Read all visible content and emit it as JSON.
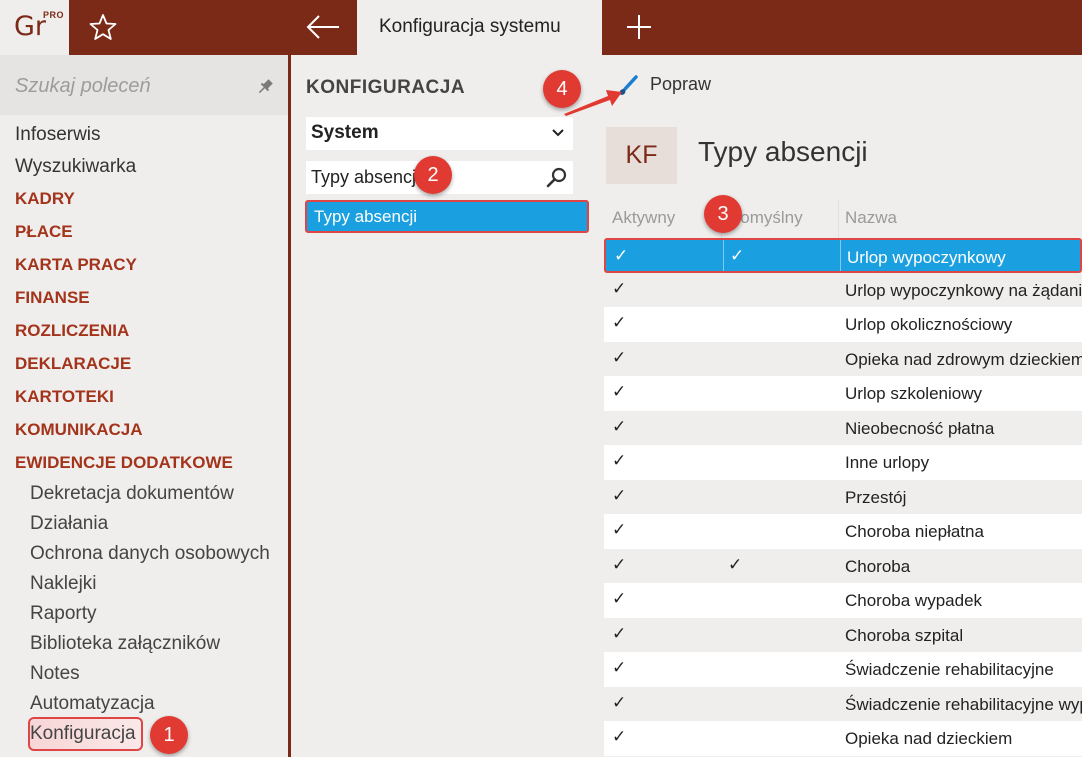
{
  "topbar": {
    "logo_text": "Gr",
    "logo_badge": "PRO",
    "tab_title": "Konfiguracja systemu",
    "icons": [
      "star-icon",
      "back-arrow-icon",
      "plus-icon"
    ]
  },
  "sidebar": {
    "search_placeholder": "Szukaj poleceń",
    "top_items": [
      "Infoserwis",
      "Wyszukiwarka"
    ],
    "sections": [
      "KADRY",
      "PŁACE",
      "KARTA PRACY",
      "FINANSE",
      "ROZLICZENIA",
      "DEKLARACJE",
      "KARTOTEKI",
      "KOMUNIKACJA",
      "EWIDENCJE DODATKOWE"
    ],
    "sub_items": [
      "Dekretacja dokumentów",
      "Działania",
      "Ochrona danych osobowych",
      "Naklejki",
      "Raporty",
      "Biblioteka załączników",
      "Notes",
      "Automatyzacja",
      "Konfiguracja"
    ]
  },
  "middle": {
    "title": "KONFIGURACJA",
    "dropdown_value": "System",
    "filter_value": "Typy absencji",
    "list_selected": "Typy absencji"
  },
  "right": {
    "toolbar_action": "Popraw",
    "avatar_initials": "KF",
    "page_title": "Typy absencji",
    "columns": [
      "Aktywny",
      "Domyślny",
      "Nazwa"
    ],
    "check_mark": "✓",
    "rows": [
      {
        "active": true,
        "default": true,
        "name": "Urlop wypoczynkowy"
      },
      {
        "active": true,
        "default": false,
        "name": "Urlop wypoczynkowy na żądanie"
      },
      {
        "active": true,
        "default": false,
        "name": "Urlop okolicznościowy"
      },
      {
        "active": true,
        "default": false,
        "name": "Opieka nad zdrowym dzieckiem"
      },
      {
        "active": true,
        "default": false,
        "name": "Urlop szkoleniowy"
      },
      {
        "active": true,
        "default": false,
        "name": "Nieobecność płatna"
      },
      {
        "active": true,
        "default": false,
        "name": "Inne urlopy"
      },
      {
        "active": true,
        "default": false,
        "name": "Przestój"
      },
      {
        "active": true,
        "default": false,
        "name": "Choroba niepłatna"
      },
      {
        "active": true,
        "default": true,
        "name": "Choroba"
      },
      {
        "active": true,
        "default": false,
        "name": "Choroba wypadek"
      },
      {
        "active": true,
        "default": false,
        "name": "Choroba szpital"
      },
      {
        "active": true,
        "default": false,
        "name": "Świadczenie rehabilitacyjne"
      },
      {
        "active": true,
        "default": false,
        "name": "Świadczenie rehabilitacyjne wypadek"
      },
      {
        "active": true,
        "default": false,
        "name": "Opieka nad dzieckiem"
      }
    ],
    "selected_row": 0
  },
  "annotations": [
    "1",
    "2",
    "3",
    "4"
  ],
  "colors": {
    "brand": "#7b2a17",
    "section_text": "#a3341b",
    "selection": "#1a9fe0",
    "highlight_border": "#e04545",
    "badge": "#e03a32"
  }
}
